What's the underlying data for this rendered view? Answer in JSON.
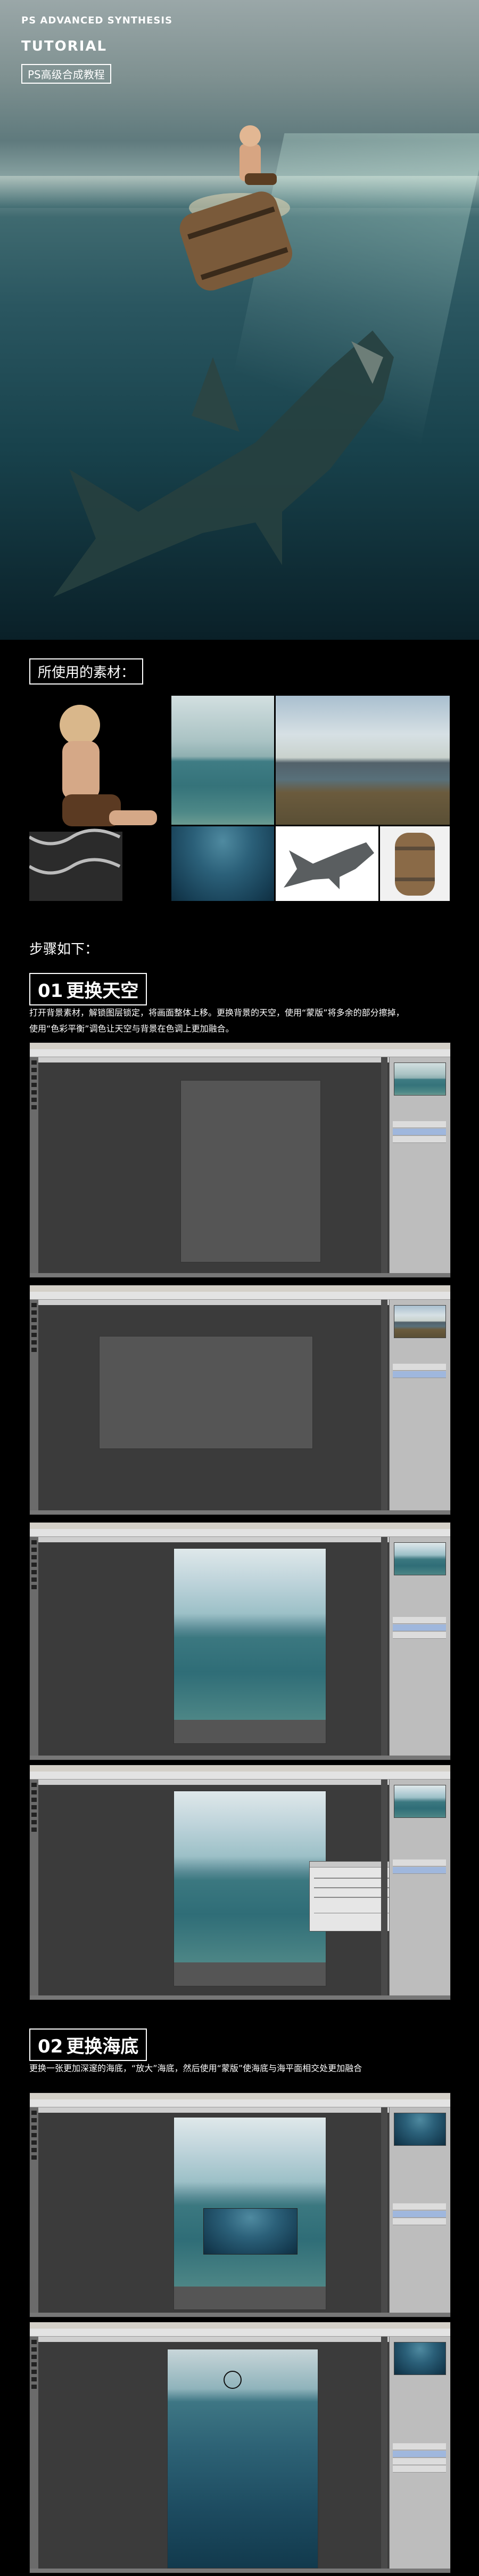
{
  "hero": {
    "title_line1": "PS ADVANCED SYNTHESIS",
    "title_line2": "TUTORIAL",
    "badge": "PS高级合成教程"
  },
  "materials": {
    "heading": "所使用的素材："
  },
  "steps": {
    "heading": "步骤如下：",
    "items": [
      {
        "num": "01",
        "title": "更换天空",
        "desc_line1": "打开背景素材，解锁图层锁定，将画面整体上移。更换背景的天空，使用“蒙版”将多余的部分擦掉，",
        "desc_line2": "使用“色彩平衡”调色让天空与背景在色调上更加融合。"
      },
      {
        "num": "02",
        "title": "更换海底",
        "desc_line1": "更换一张更加深邃的海底，“放大”海底，然后使用“蒙版”使海底与海平面相交处更加融合"
      }
    ]
  },
  "colors": {
    "background": "#000000",
    "text": "#ffffff",
    "ps_workspace": "#3b3b3b",
    "ps_panel": "#bdbdbd"
  }
}
